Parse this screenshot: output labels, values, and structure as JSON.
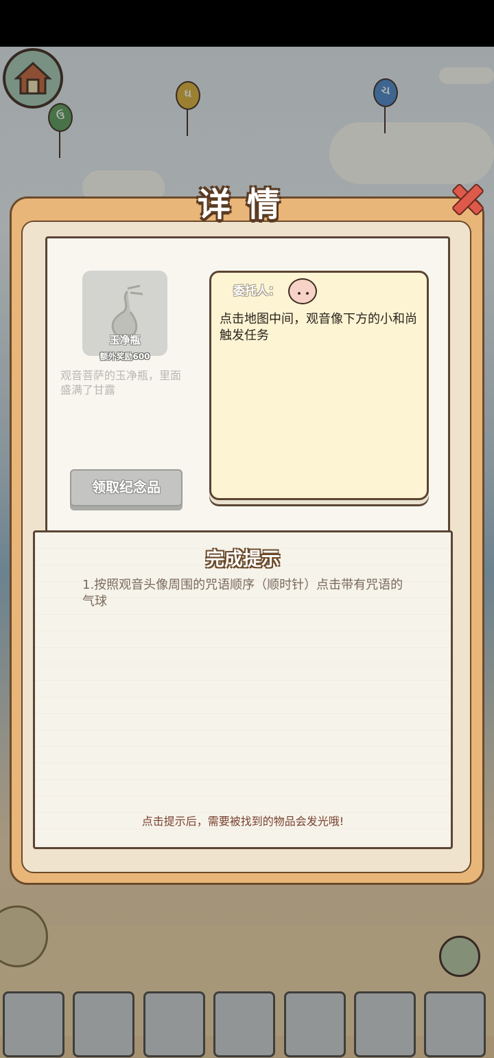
{
  "dialog": {
    "title": "详情",
    "close_icon": "close-x-icon"
  },
  "reward": {
    "item_name": "玉净瓶",
    "bonus": "额外奖励600",
    "description": "观音菩萨的玉净瓶，里面盛满了甘露",
    "claim_button": "领取纪念品",
    "icon": "vase-icon"
  },
  "client": {
    "label": "委托人：",
    "avatar": "monk-avatar-icon",
    "task": "点击地图中间，观音像下方的小和尚触发任务"
  },
  "hint": {
    "title": "完成提示",
    "text": "1.按照观音头像周围的咒语顺序（顺时针）点击带有咒语的气球",
    "note": "点击提示后，需要被找到的物品会发光哦!"
  },
  "background": {
    "balloons": [
      {
        "glyph": "ઉ",
        "color": "#5a9a5a"
      },
      {
        "glyph": "ઘ",
        "color": "#d9b03a"
      },
      {
        "glyph": "ચ",
        "color": "#4a86c8"
      }
    ],
    "home_icon": "home-icon",
    "star_icon": "star-icon",
    "book_icon": "book-icon",
    "inventory_slots": 7
  },
  "colors": {
    "panel": "#e9b679",
    "close": "#dd5a4a",
    "note_paper": "#fdf4d4"
  }
}
